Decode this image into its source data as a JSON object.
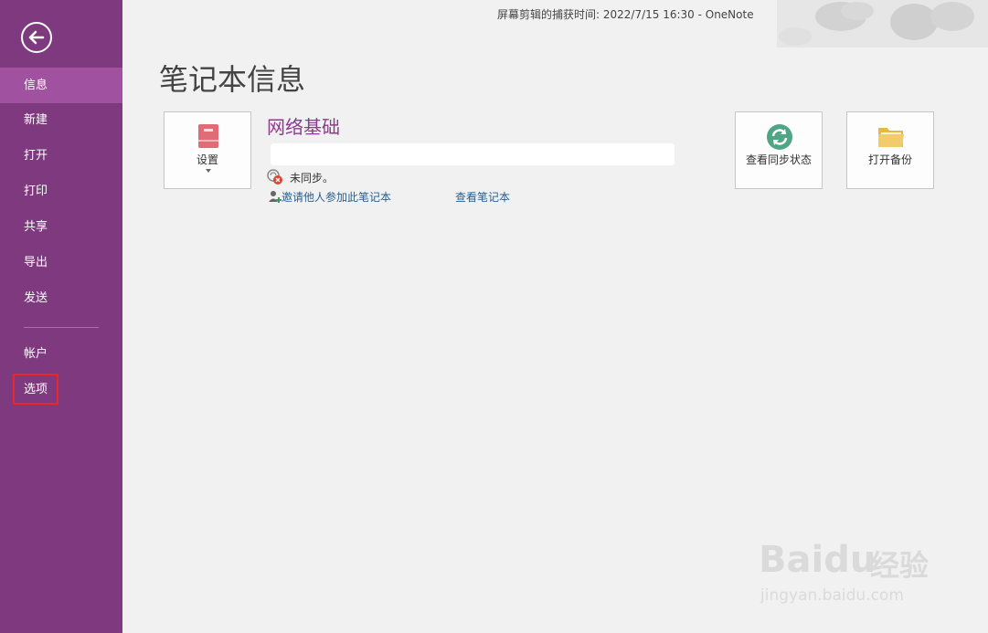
{
  "window": {
    "title": "屏幕剪辑的捕获时间: 2022/7/15 16:30 - OneNote"
  },
  "sidebar": {
    "back_icon": "back-arrow-icon",
    "items": [
      {
        "label": "信息",
        "active": true
      },
      {
        "label": "新建"
      },
      {
        "label": "打开"
      },
      {
        "label": "打印"
      },
      {
        "label": "共享"
      },
      {
        "label": "导出"
      },
      {
        "label": "发送"
      },
      {
        "label": "帐户"
      },
      {
        "label": "选项",
        "highlighted": true
      }
    ],
    "bg_color": "#7f397e",
    "active_color": "#a052a0"
  },
  "main": {
    "title": "笔记本信息",
    "settings_tile": {
      "label": "设置",
      "icon": "notebook-icon"
    },
    "notebook_name": "网络基础",
    "sync_status": "未同步。",
    "invite_link": "邀请他人参加此笔记本",
    "view_link": "查看笔记本",
    "sync_tile": {
      "label": "查看同步状态",
      "icon": "sync-icon"
    },
    "backup_tile": {
      "label": "打开备份",
      "icon": "folder-icon"
    }
  },
  "watermark": {
    "brand": "Baidu",
    "brand_cn": "经验",
    "url": "jingyan.baidu.com"
  }
}
